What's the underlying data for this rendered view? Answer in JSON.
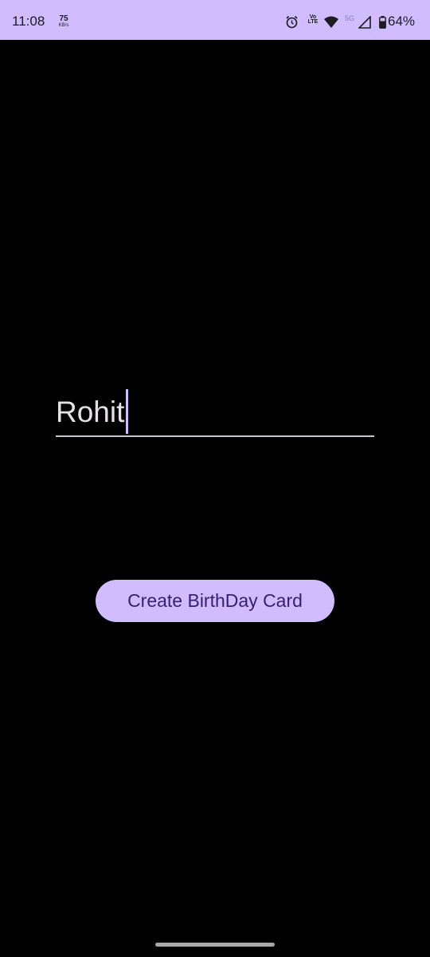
{
  "status_bar": {
    "time": "11:08",
    "net_speed_value": "75",
    "net_speed_unit": "KB/s",
    "volte_label_top": "Vo",
    "volte_label_bottom": "LTE",
    "network_type": "5G",
    "battery_percent": "64%",
    "icons": [
      "alarm-icon",
      "wifi-icon",
      "signal-icon",
      "battery-icon"
    ],
    "background_color": "#d0bcff"
  },
  "form": {
    "name_value": "Rohit",
    "create_button_label": "Create BirthDay Card"
  },
  "colors": {
    "accent": "#d0bcff",
    "background": "#000000",
    "button_text": "#381e72"
  }
}
